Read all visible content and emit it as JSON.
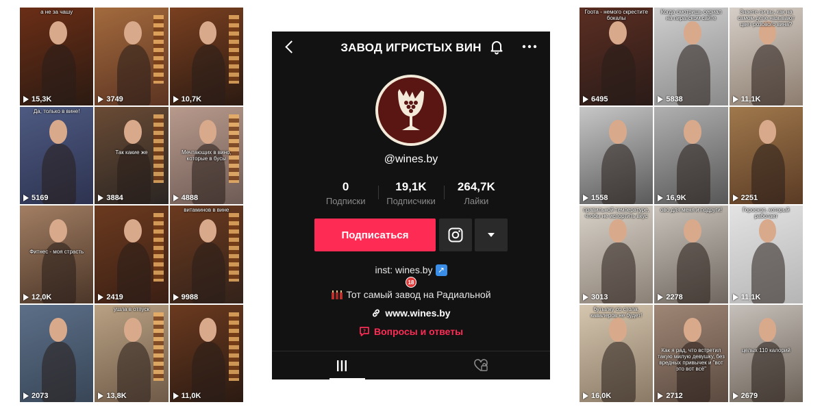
{
  "left_grid": [
    {
      "views": "15,3K",
      "caption": "а не за чашу",
      "caption_pos": "top",
      "bg": [
        "#6b2e16",
        "#2b1a12"
      ]
    },
    {
      "views": "3749",
      "caption": "",
      "caption_pos": "top",
      "bg": [
        "#a36a3d",
        "#5c3422"
      ]
    },
    {
      "views": "10,7K",
      "caption": "",
      "caption_pos": "top",
      "bg": [
        "#7a4020",
        "#2c1a12"
      ]
    },
    {
      "views": "5169",
      "caption": "Да, только в вине!",
      "caption_pos": "top",
      "bg": [
        "#4e5a82",
        "#2d3350"
      ]
    },
    {
      "views": "3884",
      "caption": "Так какие же",
      "caption_pos": "mid",
      "bg": [
        "#6a4b35",
        "#2a2522"
      ]
    },
    {
      "views": "4888",
      "caption": "Мечтающих в вино, которые в бусы",
      "caption_pos": "mid",
      "bg": [
        "#b89a8c",
        "#6e5b55"
      ]
    },
    {
      "views": "12,0K",
      "caption": "Фитнес - моя страсть",
      "caption_pos": "mid",
      "bg": [
        "#a27e63",
        "#4b3628"
      ]
    },
    {
      "views": "2419",
      "caption": "",
      "caption_pos": "top",
      "bg": [
        "#6b3a1f",
        "#3b1f14"
      ]
    },
    {
      "views": "9988",
      "caption": "витаминов в вине",
      "caption_pos": "top",
      "bg": [
        "#6b3a1f",
        "#33221a"
      ]
    },
    {
      "views": "2073",
      "caption": "",
      "caption_pos": "top",
      "bg": [
        "#5c6f88",
        "#384657"
      ]
    },
    {
      "views": "13,8K",
      "caption": "ушла в отпуск",
      "caption_pos": "top",
      "bg": [
        "#b8a183",
        "#6f5a48"
      ]
    },
    {
      "views": "11,0K",
      "caption": "",
      "caption_pos": "top",
      "bg": [
        "#6b3a1f",
        "#2b1a12"
      ]
    }
  ],
  "right_grid": [
    {
      "views": "6495",
      "caption": "Гоотa - немого скреститe бокалы",
      "caption_pos": "top",
      "bg": [
        "#5b2e22",
        "#2a1b18"
      ]
    },
    {
      "views": "5838",
      "caption": "Когда смотришь сериал на пиратском сайте",
      "caption_pos": "top",
      "bg": [
        "#cfcfcf",
        "#8a8a8a"
      ]
    },
    {
      "views": "11,1K",
      "caption": "Знаете ли вы, как на самом деле называют цвет розового вина?",
      "caption_pos": "top",
      "bg": [
        "#d6cfc8",
        "#8c7c6e"
      ]
    },
    {
      "views": "1558",
      "caption": "",
      "caption_pos": "top",
      "bg": [
        "#c7c7c7",
        "#5a5a5a"
      ]
    },
    {
      "views": "16,9K",
      "caption": "",
      "caption_pos": "top",
      "bg": [
        "#b0b0b0",
        "#575757"
      ]
    },
    {
      "views": "2251",
      "caption": "",
      "caption_pos": "top",
      "bg": [
        "#a0784c",
        "#5a3b24"
      ]
    },
    {
      "views": "3013",
      "caption": "правильной температуре, чтобы не испортить вкус",
      "caption_pos": "top",
      "bg": [
        "#d8d2c8",
        "#8b8076"
      ]
    },
    {
      "views": "2278",
      "caption": "ово для меня и подруги!",
      "caption_pos": "top",
      "bg": [
        "#c9c3bb",
        "#6f675f"
      ]
    },
    {
      "views": "11,1K",
      "caption": "Гороскоп, который работает",
      "caption_pos": "top",
      "bg": [
        "#e3e3e3",
        "#b5b5b5"
      ]
    },
    {
      "views": "16,0K",
      "caption": "бутылку со стола, кавалеров не будет!",
      "caption_pos": "top",
      "bg": [
        "#d5c6b0",
        "#8a7a65"
      ]
    },
    {
      "views": "2712",
      "caption": "Как я рад, что встретил такую милую девушку, без вредных привычек и \"вот это вот всё\"",
      "caption_pos": "mid",
      "bg": [
        "#9f8675",
        "#5b4a40"
      ]
    },
    {
      "views": "2679",
      "caption": "целых 110 калорий",
      "caption_pos": "mid",
      "bg": [
        "#c6c0ba",
        "#6c6258"
      ]
    }
  ],
  "profile": {
    "title": "ЗАВОД ИГРИСТЫХ ВИН",
    "username": "@wines.by",
    "stats": [
      {
        "value": "0",
        "label": "Подписки"
      },
      {
        "value": "19,1K",
        "label": "Подписчики"
      },
      {
        "value": "264,7K",
        "label": "Лайки"
      }
    ],
    "subscribe_label": "Подписаться",
    "bio_line1": "inst: wines.by",
    "bio_age": "18",
    "bio_line3": "Тот самый завод на Радиальной",
    "link": "www.wines.by",
    "qa": "Вопросы и ответы",
    "colors": {
      "accent": "#fe2c55",
      "bg": "#121212",
      "logo_bg": "#5a1613",
      "logo_fg": "#f3ead9"
    }
  }
}
